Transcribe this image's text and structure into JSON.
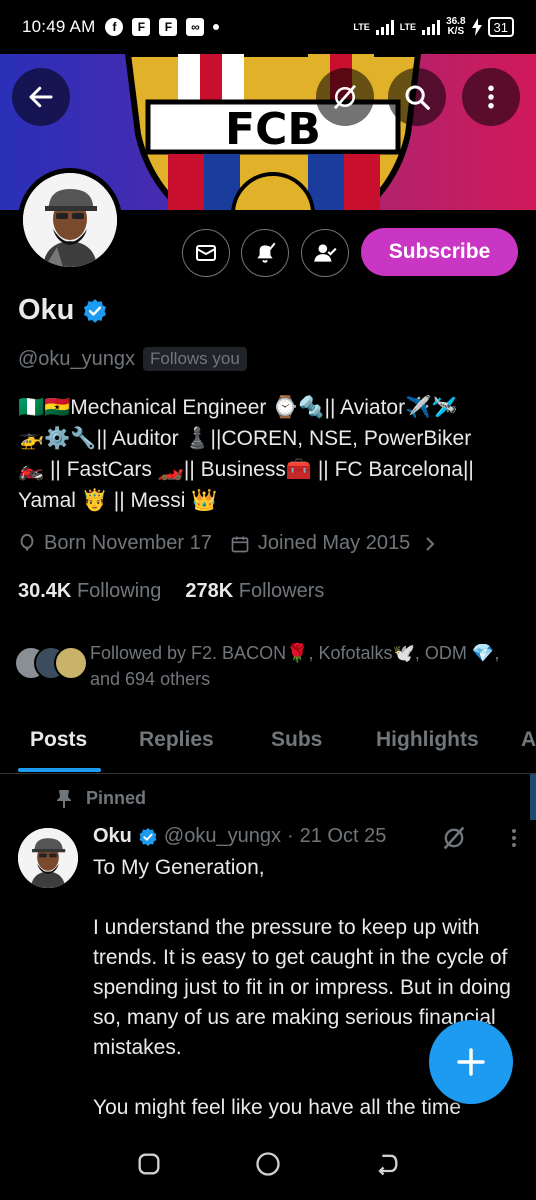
{
  "status_bar": {
    "time": "10:49 AM",
    "notification_icons": [
      "facebook-icon",
      "flipboard-icon",
      "flipboard-icon",
      "infinity-icon"
    ],
    "network_labels": [
      "LTE",
      "LTE"
    ],
    "network_speed_value": "36.8",
    "network_speed_unit": "K/S",
    "battery": "31"
  },
  "header": {
    "back_icon": "arrow-left-icon",
    "grok_icon": "grok-icon",
    "search_icon": "search-icon",
    "more_icon": "more-vertical-icon",
    "banner_text": "FCB",
    "banner_colors": [
      "#2a2fb8",
      "#d1195a"
    ]
  },
  "profile": {
    "name": "Oku",
    "verified": true,
    "handle": "@oku_yungx",
    "follows_you": "Follows you",
    "subscribe_label": "Subscribe",
    "bio_lines": [
      "🇳🇬🇬🇭Mechanical Engineer ⌚🔩|| Aviator✈️🛩️",
      "🚁⚙️🔧|| Auditor ♟️||COREN, NSE, PowerBiker",
      "🏍️ || FastCars 🏎️|| Business🧰 || FC Barcelona||",
      "Yamal 🤴 || Messi 👑"
    ],
    "born": "Born November 17",
    "joined": "Joined May 2015",
    "following_count": "30.4K",
    "following_label": "Following",
    "followers_count": "278K",
    "followers_label": "Followers",
    "followed_by_text": "Followed by F2. BACON🌹, Kofotalks🕊️, ODM 💎, and 694 others"
  },
  "tabs": [
    {
      "label": "Posts",
      "active": true
    },
    {
      "label": "Replies",
      "active": false
    },
    {
      "label": "Subs",
      "active": false
    },
    {
      "label": "Highlights",
      "active": false
    },
    {
      "label": "A",
      "active": false
    }
  ],
  "pinned_post": {
    "pinned_label": "Pinned",
    "author_name": "Oku",
    "author_handle": "@oku_yungx",
    "separator": "·",
    "date": "21 Oct 25",
    "paragraphs": [
      "To My Generation,",
      "I understand the pressure to keep up with trends. It is easy to get caught in the cycle of spending just to fit in or impress. But in doing so, many of us are making serious financial mistakes.",
      "You might feel like you have all the time"
    ]
  },
  "colors": {
    "accent": "#1d9bf0",
    "subscribe": "#c936c4",
    "muted_text": "#71767b",
    "background": "#000000"
  },
  "nav_bar": {
    "icons": [
      "recents-icon",
      "home-icon",
      "back-icon"
    ]
  }
}
